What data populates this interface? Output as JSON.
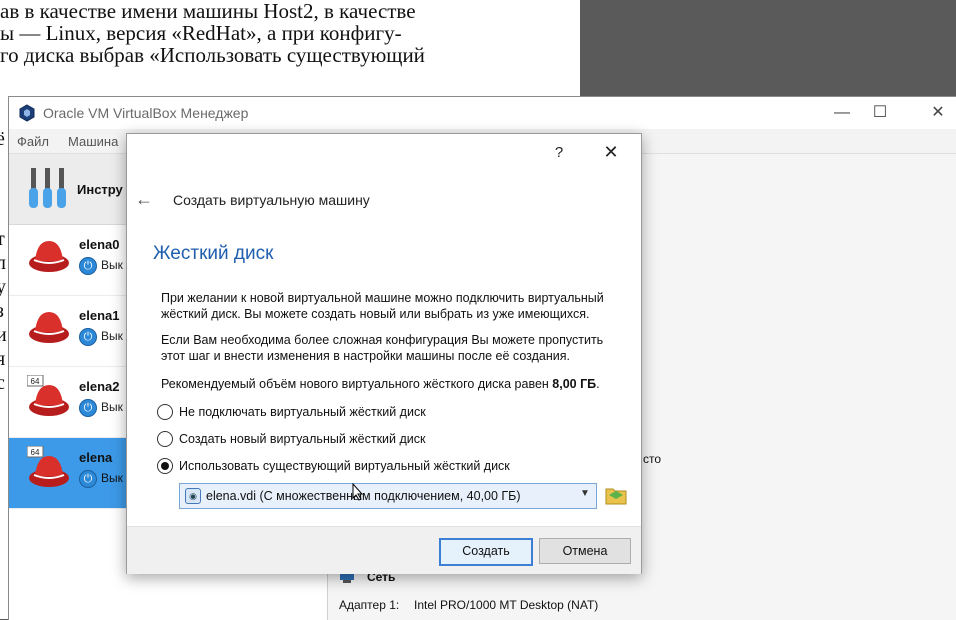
{
  "document": {
    "lines": [
      "ав в качестве имени машины Host2, в качестве",
      "ы — Linux, версия «RedHat», а при конфигу-",
      "го диска выбрав «Использовать существующий"
    ],
    "side_fragments": [
      "ё",
      "т",
      "л",
      "у",
      "з",
      "и",
      "я",
      "с"
    ]
  },
  "window": {
    "title": "Oracle VM VirtualBox Менеджер",
    "minimize_glyph": "—",
    "maximize_glyph": "☐",
    "close_glyph": "✕"
  },
  "menubar": {
    "items": [
      "Файл",
      "Машина"
    ]
  },
  "tools": {
    "label": "Инстру"
  },
  "vms": [
    {
      "name": "elena0",
      "status": "Вык",
      "badge": ""
    },
    {
      "name": "elena1",
      "status": "Вык",
      "badge": ""
    },
    {
      "name": "elena2",
      "status": "Вык",
      "badge": "64"
    },
    {
      "name": "elena",
      "status": "Вык",
      "badge": "64",
      "selected": true
    }
  ],
  "details": {
    "fragment": "сто",
    "network_header": "Сеть",
    "adapter_label": "Адаптер 1:",
    "adapter_value": "Intel PRO/1000 MT Desktop (NAT)"
  },
  "dialog": {
    "help_glyph": "?",
    "close_glyph": "✕",
    "back_glyph": "←",
    "wizard_title": "Создать виртуальную машину",
    "heading": "Жесткий диск",
    "para1": "При желании к новой виртуальной машине можно подключить виртуальный жёсткий диск. Вы можете создать новый или выбрать из уже имеющихся.",
    "para2": "Если Вам необходима более сложная конфигурация Вы можете пропустить этот шаг и внести изменения в настройки машины после её создания.",
    "recommend_text": "Рекомендуемый объём нового виртуального жёсткого диска равен",
    "recommend_value": "8,00 ГБ",
    "recommend_end": ".",
    "options": [
      {
        "label": "Не подключать виртуальный жёсткий диск",
        "checked": false
      },
      {
        "label": "Создать новый виртуальный жёсткий диск",
        "checked": false
      },
      {
        "label": "Использовать существующий виртуальный жёсткий диск",
        "checked": true
      }
    ],
    "disk_select": "elena.vdi (С множественным подключением, 40,00 ГБ)",
    "create_button": "Создать",
    "cancel_button": "Отмена"
  },
  "colors": {
    "heading": "#1f5fae",
    "selection": "#3d9ae8",
    "power_icon": "#2c89d8",
    "combo_border": "#7aa7d8"
  }
}
